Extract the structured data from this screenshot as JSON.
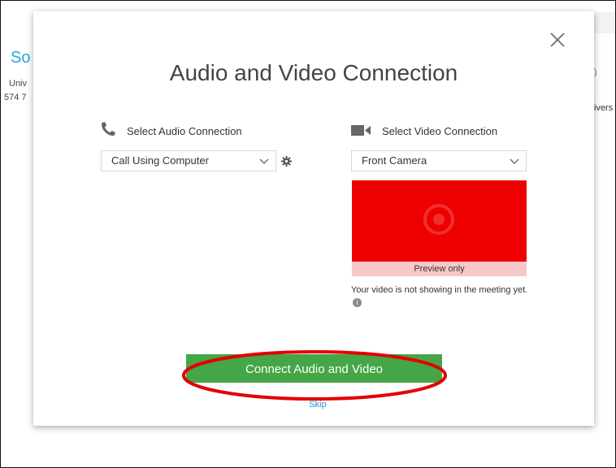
{
  "background": {
    "title_fragment": "So",
    "line1_fragment": "Univ",
    "line2_fragment": "574 7",
    "right_fragment1": ")",
    "right_fragment2": "ivers"
  },
  "dialog": {
    "title": "Audio and Video Connection",
    "close_icon": "close-icon",
    "audio": {
      "label": "Select Audio Connection",
      "icon": "phone-icon",
      "selected": "Call Using Computer",
      "settings_icon": "gear-icon"
    },
    "video": {
      "label": "Select Video Connection",
      "icon": "video-camera-icon",
      "selected": "Front Camera",
      "preview_label": "Preview only",
      "note": "Your video is not showing in the meeting yet.",
      "info_icon": "info-icon"
    },
    "connect_button": "Connect Audio and Video",
    "skip_link": "Skip"
  },
  "colors": {
    "accent_green": "#44a646",
    "preview_red": "#ee0000",
    "annotation_ring": "#e30000",
    "link_blue": "#2a8fd1"
  }
}
